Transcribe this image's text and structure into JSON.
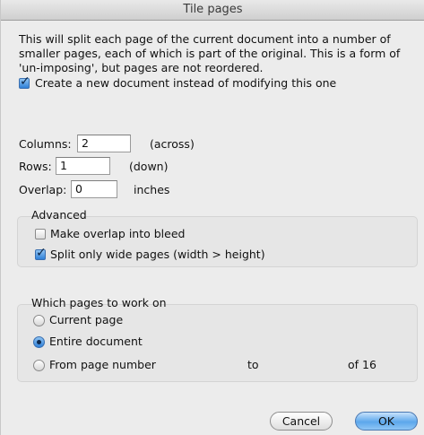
{
  "window": {
    "title": "Tile pages"
  },
  "description": "This will split each page of the current document into a number of smaller pages, each of which is part of the original. This is a form of 'un-imposing', but pages are not reordered.",
  "options": {
    "new_document_label": "Create a new document instead of modifying this one",
    "new_document_checked": true
  },
  "fields": {
    "columns": {
      "label": "Columns:",
      "value": "2",
      "unit": "(across)"
    },
    "rows": {
      "label": "Rows:",
      "value": "1",
      "unit": "(down)"
    },
    "overlap": {
      "label": "Overlap:",
      "value": "0",
      "unit": "inches"
    }
  },
  "advanced": {
    "title": "Advanced",
    "overlap_bleed_label": "Make overlap into bleed",
    "overlap_bleed_checked": false,
    "split_wide_label": "Split only wide pages (width > height)",
    "split_wide_checked": true
  },
  "pages": {
    "title": "Which pages to work on",
    "current_label": "Current page",
    "entire_label": "Entire document",
    "from_label": "From page number",
    "to_label": "to",
    "of_label": "of 16",
    "selected": "Entire document"
  },
  "buttons": {
    "cancel": "Cancel",
    "ok": "OK"
  }
}
